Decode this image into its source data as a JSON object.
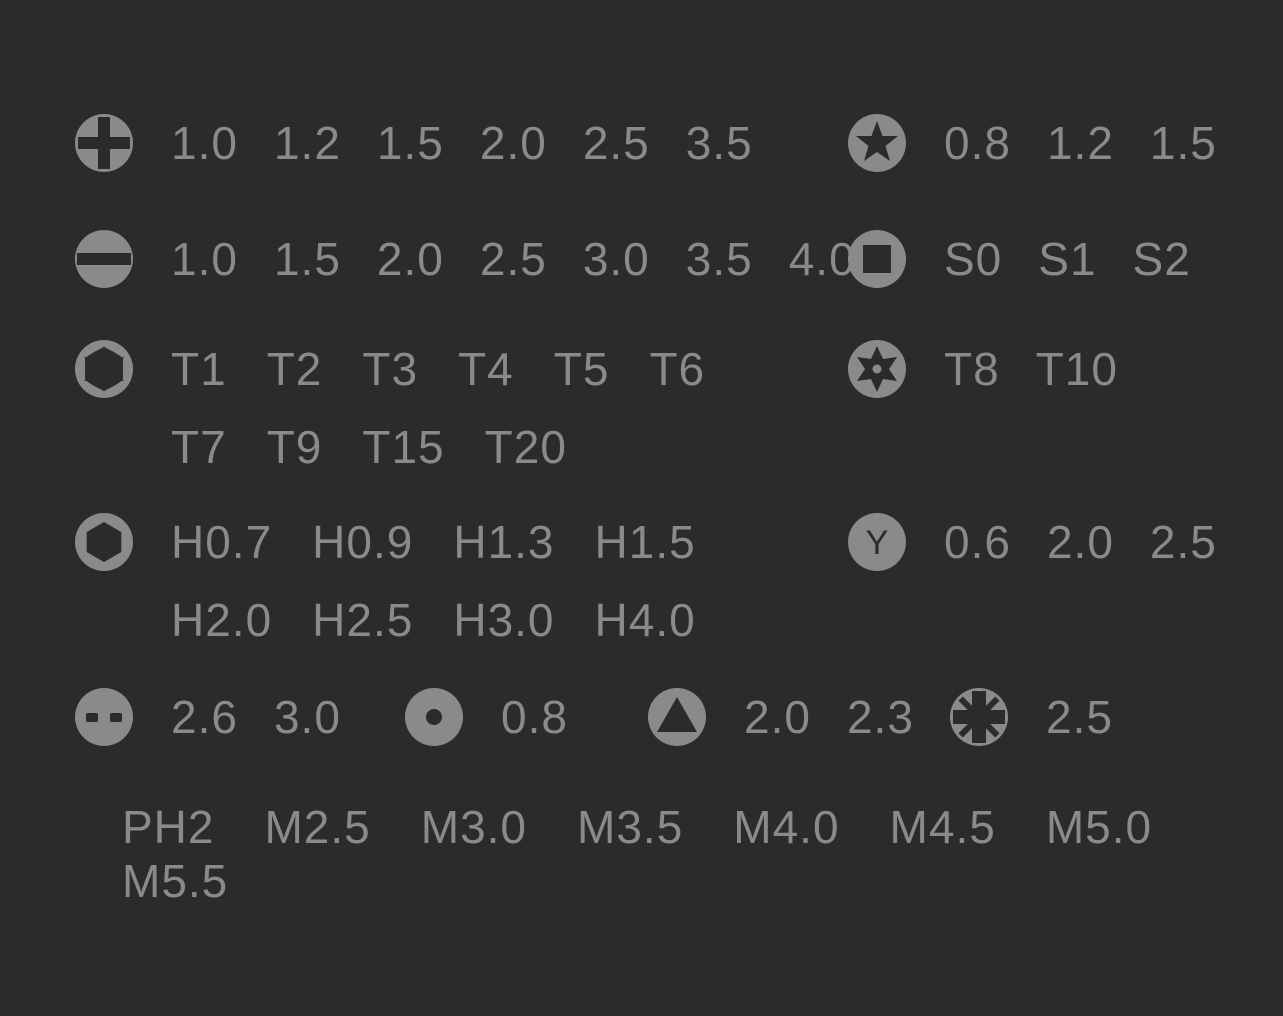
{
  "colors": {
    "background": "#2b2b2b",
    "icon_fill": "#8a8a8a",
    "icon_fg": "#2b2b2b",
    "text": "#8a8a8a"
  },
  "groups": {
    "phillips": {
      "icon": "phillips",
      "sizes": [
        "1.0",
        "1.2",
        "1.5",
        "2.0",
        "2.5",
        "3.5"
      ]
    },
    "pentalobe": {
      "icon": "star5",
      "sizes": [
        "0.8",
        "1.2",
        "1.5"
      ]
    },
    "slotted": {
      "icon": "slot",
      "sizes": [
        "1.0",
        "1.5",
        "2.0",
        "2.5",
        "3.0",
        "3.5",
        "4.0"
      ]
    },
    "square": {
      "icon": "square",
      "sizes": [
        "S0",
        "S1",
        "S2"
      ]
    },
    "torx": {
      "icon": "torx",
      "sizes": [
        "T1",
        "T2",
        "T3",
        "T4",
        "T5",
        "T6",
        "T7",
        "T9",
        "T15",
        "T20"
      ]
    },
    "torx_security": {
      "icon": "torx-security",
      "sizes": [
        "T8",
        "T10"
      ]
    },
    "hex": {
      "icon": "hex",
      "sizes": [
        "H0.7",
        "H0.9",
        "H1.3",
        "H1.5",
        "H2.0",
        "H2.5",
        "H3.0",
        "H4.0"
      ]
    },
    "tri_wing": {
      "icon": "ylabel",
      "sizes": [
        "0.6",
        "2.0",
        "2.5"
      ]
    },
    "spanner": {
      "icon": "spanner",
      "sizes": [
        "2.6",
        "3.0"
      ]
    },
    "standoff": {
      "icon": "dot",
      "sizes": [
        "0.8"
      ]
    },
    "triangle": {
      "icon": "triangle",
      "sizes": [
        "2.0",
        "2.3"
      ]
    },
    "pozidriv": {
      "icon": "pozi",
      "sizes": [
        "2.5"
      ]
    },
    "misc": {
      "sizes": [
        "PH2",
        "M2.5",
        "M3.0",
        "M3.5",
        "M4.0",
        "M4.5",
        "M5.0",
        "M5.5"
      ]
    }
  }
}
